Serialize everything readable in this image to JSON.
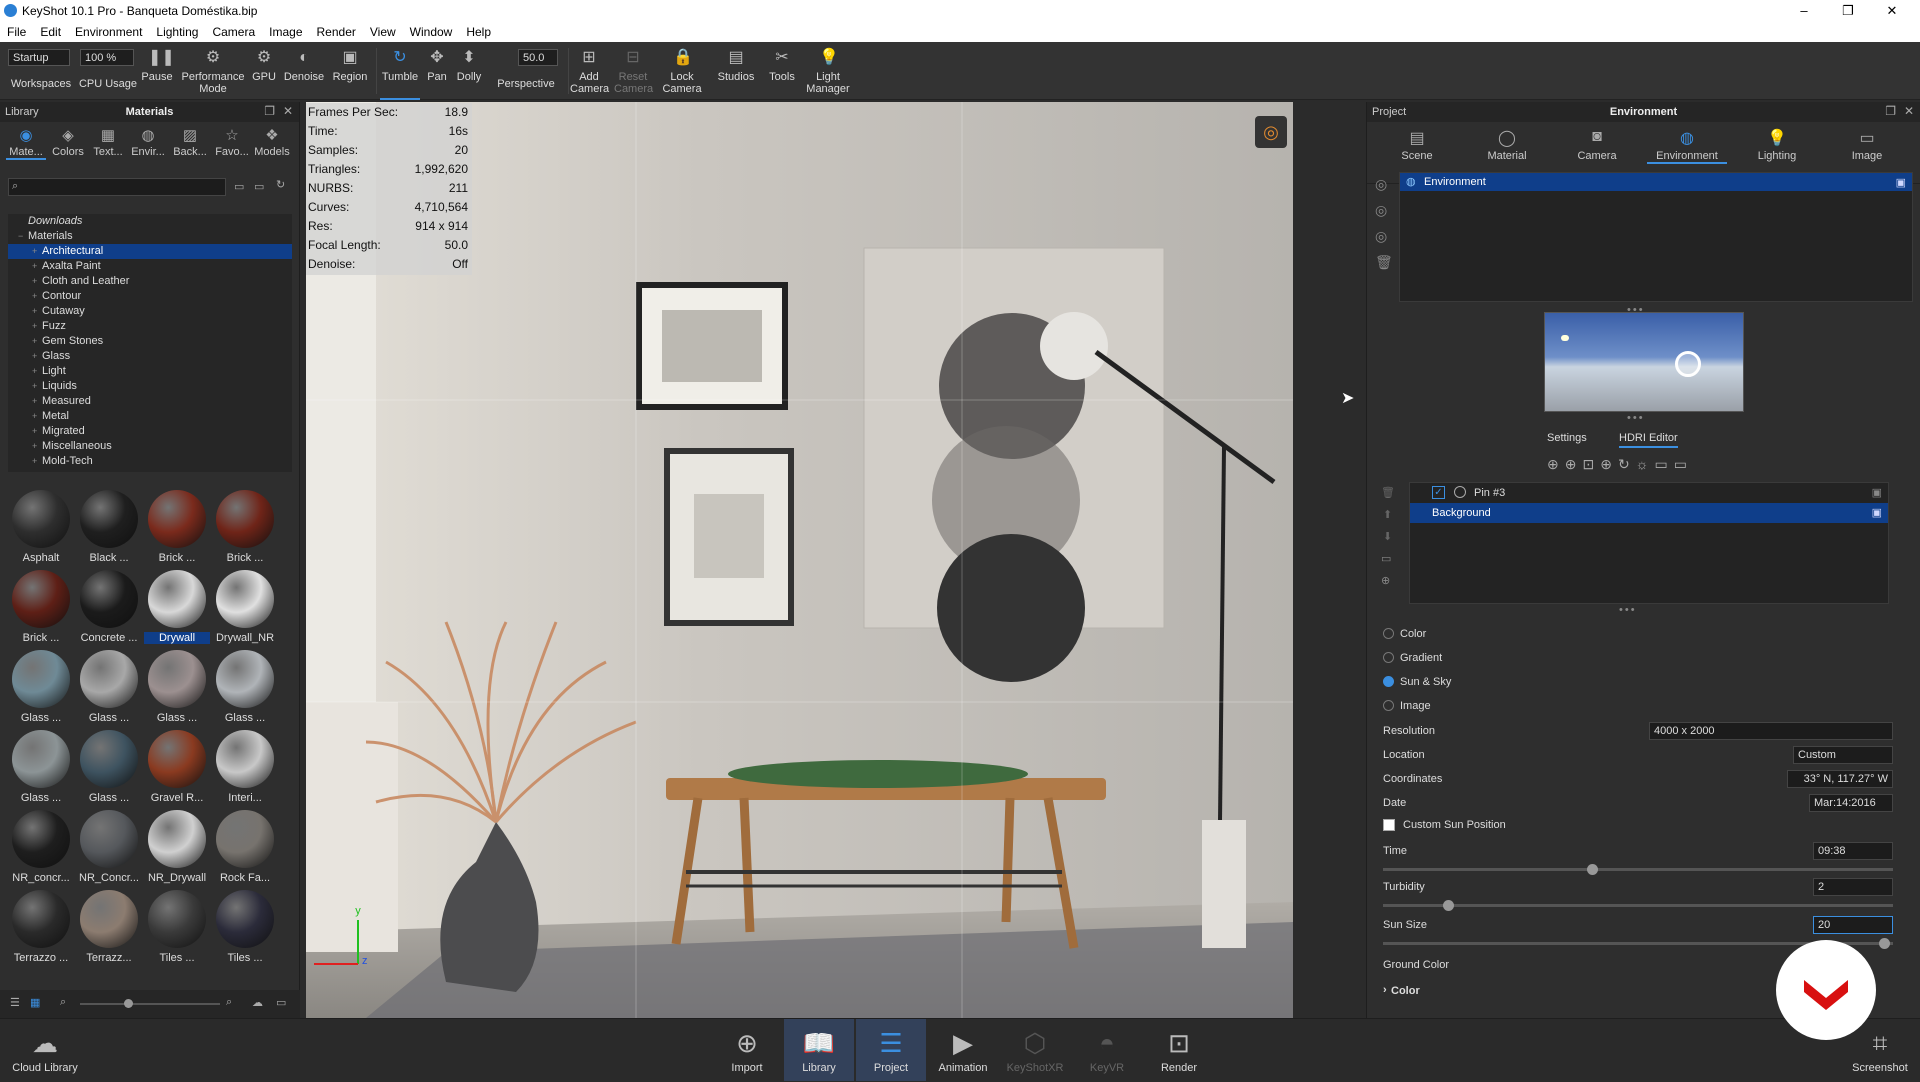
{
  "window": {
    "title": "KeyShot 10.1 Pro - Banqueta Doméstika.bip",
    "minimize": "–",
    "maximize": "❐",
    "close": "✕"
  },
  "menu": [
    "File",
    "Edit",
    "Environment",
    "Lighting",
    "Camera",
    "Image",
    "Render",
    "View",
    "Window",
    "Help"
  ],
  "toolbar": {
    "workspace_value": "Startup",
    "cpu_value": "100 %",
    "fov_value": "50.0",
    "items": [
      {
        "label": "Workspaces",
        "icon": "workspaces-icon"
      },
      {
        "label": "CPU Usage",
        "icon": "cpu-icon"
      },
      {
        "label": "Pause",
        "icon": "pause-icon"
      },
      {
        "label": "Performance Mode",
        "icon": "performance-icon"
      },
      {
        "label": "GPU",
        "icon": "gpu-icon"
      },
      {
        "label": "Denoise",
        "icon": "denoise-icon"
      },
      {
        "label": "Region",
        "icon": "region-icon"
      },
      {
        "label": "Tumble",
        "icon": "tumble-icon"
      },
      {
        "label": "Pan",
        "icon": "pan-icon"
      },
      {
        "label": "Dolly",
        "icon": "dolly-icon"
      },
      {
        "label": "Perspective",
        "icon": "perspective-icon"
      },
      {
        "label": "Add Camera",
        "icon": "add-camera-icon"
      },
      {
        "label": "Reset Camera",
        "icon": "reset-camera-icon"
      },
      {
        "label": "Lock Camera",
        "icon": "lock-camera-icon"
      },
      {
        "label": "Studios",
        "icon": "studios-icon"
      },
      {
        "label": "Tools",
        "icon": "tools-icon"
      },
      {
        "label": "Light Manager",
        "icon": "light-manager-icon"
      }
    ]
  },
  "library": {
    "header_left": "Library",
    "header_title": "Materials",
    "tabs": [
      {
        "label": "Mate..."
      },
      {
        "label": "Colors"
      },
      {
        "label": "Text..."
      },
      {
        "label": "Envir..."
      },
      {
        "label": "Back..."
      },
      {
        "label": "Favo..."
      },
      {
        "label": "Models"
      }
    ],
    "tree": [
      "Downloads",
      "Materials",
      "Architectural",
      "Axalta Paint",
      "Cloth and Leather",
      "Contour",
      "Cutaway",
      "Fuzz",
      "Gem Stones",
      "Glass",
      "Light",
      "Liquids",
      "Measured",
      "Metal",
      "Migrated",
      "Miscellaneous",
      "Mold-Tech"
    ],
    "thumbs": [
      {
        "label": "Asphalt",
        "color": "#2e2e2e"
      },
      {
        "label": "Black ...",
        "color": "#1f1f1f"
      },
      {
        "label": "Brick ...",
        "color": "#7a2a1c"
      },
      {
        "label": "Brick ...",
        "color": "#6f2418"
      },
      {
        "label": "Brick ...",
        "color": "#5e1f16"
      },
      {
        "label": "Concrete ...",
        "color": "#1b1b1b"
      },
      {
        "label": "Drywall",
        "color": "#d8d8d8"
      },
      {
        "label": "Drywall_NR",
        "color": "#e0e0e0"
      },
      {
        "label": "Glass ...",
        "color": "#6f8a96"
      },
      {
        "label": "Glass ...",
        "color": "#a8a8a8"
      },
      {
        "label": "Glass ...",
        "color": "#9c9090"
      },
      {
        "label": "Glass ...",
        "color": "#b0b4b8"
      },
      {
        "label": "Glass ...",
        "color": "#8c9496"
      },
      {
        "label": "Glass ...",
        "color": "#3e5360"
      },
      {
        "label": "Gravel R...",
        "color": "#8a3a20"
      },
      {
        "label": "Interi...",
        "color": "#c8c8c8"
      },
      {
        "label": "NR_concr...",
        "color": "#1e1e1e"
      },
      {
        "label": "NR_Concr...",
        "color": "#55585c"
      },
      {
        "label": "NR_Drywall",
        "color": "#d0d0d0"
      },
      {
        "label": "Rock Fa...",
        "color": "#77736e"
      },
      {
        "label": "Terrazzo ...",
        "color": "#2a2a2a"
      },
      {
        "label": "Terrazz...",
        "color": "#8c7c70"
      },
      {
        "label": "Tiles ...",
        "color": "#3a3a3a"
      },
      {
        "label": "Tiles ...",
        "color": "#2b2b3a"
      }
    ]
  },
  "stats": [
    {
      "k": "Frames Per Sec:",
      "v": "18.9"
    },
    {
      "k": "Time:",
      "v": "16s"
    },
    {
      "k": "Samples:",
      "v": "20"
    },
    {
      "k": "Triangles:",
      "v": "1,992,620"
    },
    {
      "k": "NURBS:",
      "v": "211"
    },
    {
      "k": "Curves:",
      "v": "4,710,564"
    },
    {
      "k": "Res:",
      "v": "914 x 914"
    },
    {
      "k": "Focal Length:",
      "v": "50.0"
    },
    {
      "k": "Denoise:",
      "v": "Off"
    }
  ],
  "project": {
    "header_left": "Project",
    "header_title": "Environment",
    "tabs": [
      {
        "label": "Scene"
      },
      {
        "label": "Material"
      },
      {
        "label": "Camera"
      },
      {
        "label": "Environment"
      },
      {
        "label": "Lighting"
      },
      {
        "label": "Image"
      }
    ],
    "env_item": "Environment",
    "subtabs": [
      "Settings",
      "HDRI Editor"
    ],
    "pins": [
      "Pin #3",
      "Background"
    ],
    "radios": [
      "Color",
      "Gradient",
      "Sun & Sky",
      "Image"
    ],
    "resolution": {
      "label": "Resolution",
      "value": "4000 x 2000"
    },
    "location": {
      "label": "Location",
      "value": "Custom"
    },
    "coordinates": {
      "label": "Coordinates",
      "value": "33° N, 117.27° W"
    },
    "date": {
      "label": "Date",
      "value": "Mar:14:2016"
    },
    "custom_sun": "Custom Sun Position",
    "time": {
      "label": "Time",
      "value": "09:38"
    },
    "turbidity": {
      "label": "Turbidity",
      "value": "2"
    },
    "sunsize": {
      "label": "Sun Size",
      "value": "20"
    },
    "ground": {
      "label": "Ground Color"
    },
    "color_section": "Color"
  },
  "bottom": {
    "cloud": "Cloud Library",
    "items": [
      {
        "label": "Import"
      },
      {
        "label": "Library"
      },
      {
        "label": "Project"
      },
      {
        "label": "Animation"
      },
      {
        "label": "KeyShotXR"
      },
      {
        "label": "KeyVR"
      },
      {
        "label": "Render"
      }
    ],
    "screenshot": "Screenshot"
  }
}
